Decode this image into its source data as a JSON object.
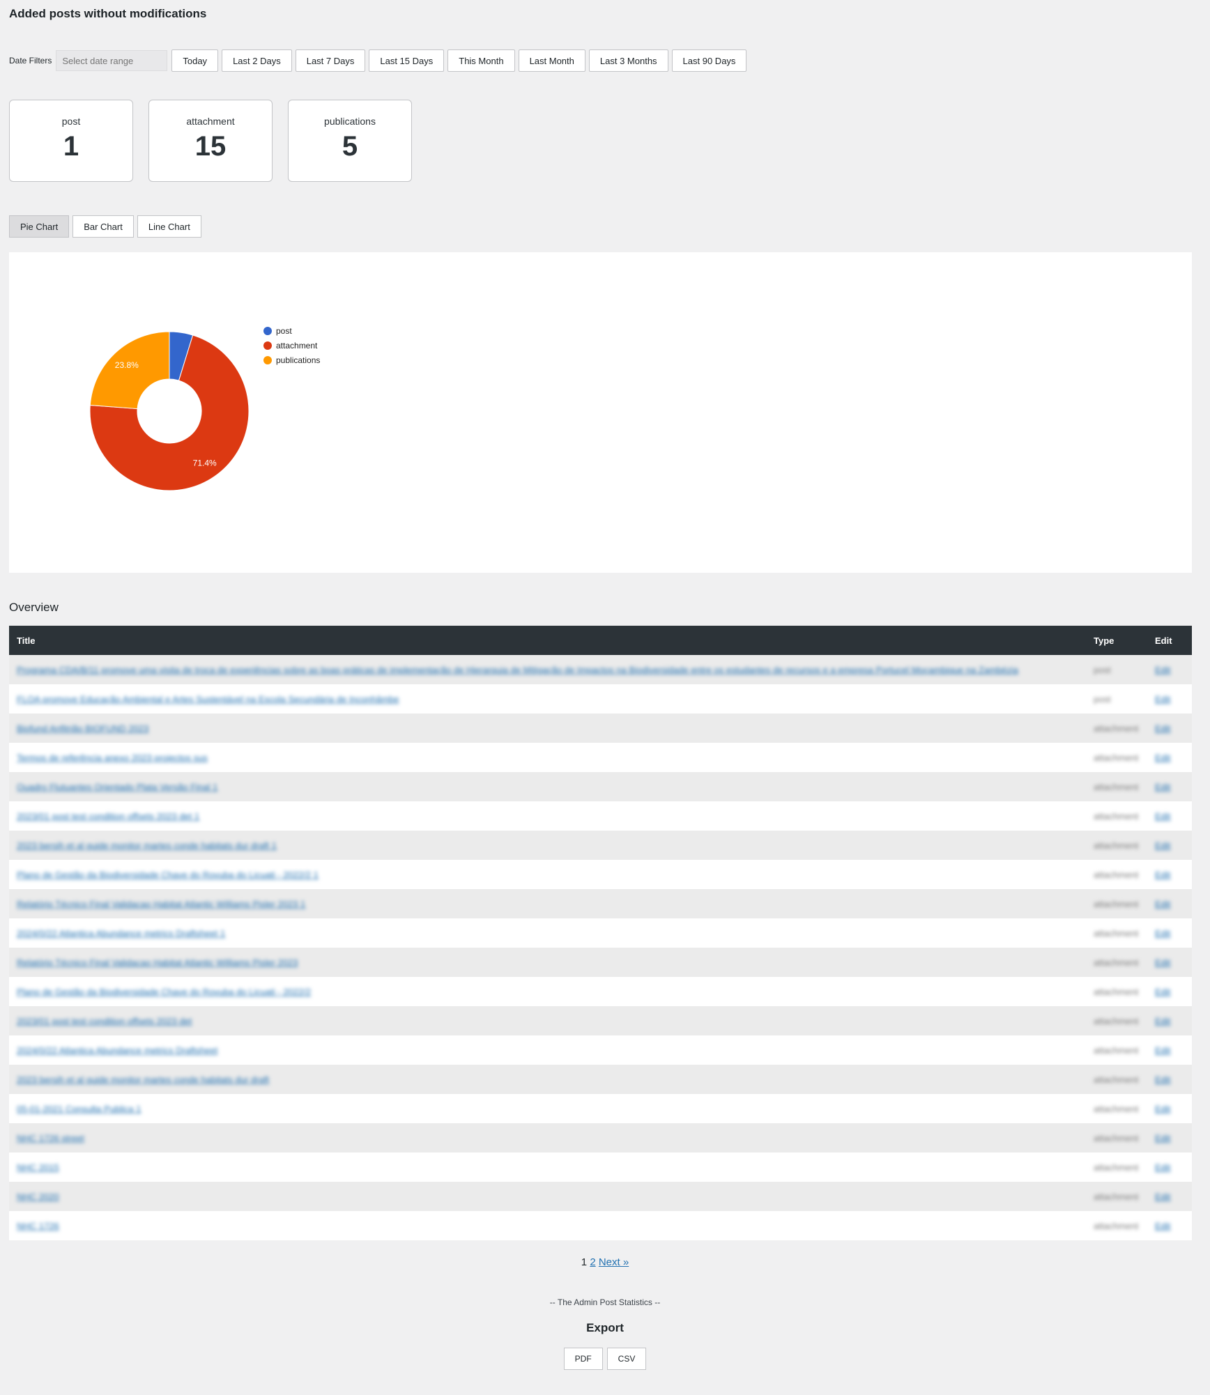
{
  "page": {
    "title": "Added posts without modifications"
  },
  "filters": {
    "label": "Date Filters",
    "date_range_placeholder": "Select date range",
    "buttons": [
      "Today",
      "Last 2 Days",
      "Last 7 Days",
      "Last 15 Days",
      "This Month",
      "Last Month",
      "Last 3 Months",
      "Last 90 Days"
    ]
  },
  "cards": [
    {
      "name": "post",
      "count": "1"
    },
    {
      "name": "attachment",
      "count": "15"
    },
    {
      "name": "publications",
      "count": "5"
    }
  ],
  "chart_tabs": [
    {
      "label": "Pie Chart",
      "active": true
    },
    {
      "label": "Bar Chart",
      "active": false
    },
    {
      "label": "Line Chart",
      "active": false
    }
  ],
  "chart_data": {
    "type": "pie",
    "donut": true,
    "categories": [
      "post",
      "attachment",
      "publications"
    ],
    "values": [
      1,
      15,
      5
    ],
    "slice_labels": [
      "",
      "71.4%",
      "23.8%"
    ],
    "colors": [
      "#3366cc",
      "#dc3912",
      "#ff9900"
    ],
    "legend_position": "right"
  },
  "overview": {
    "title": "Overview",
    "columns": [
      "Title",
      "Type",
      "Edit"
    ],
    "rows": [
      {
        "title": "Programa CDA/B/11 promove uma visita de troca de experiências sobre as boas práticas de implementação de Hierarquia de Mitigação de Impactos na Biodiversidade entre os estudantes de recursos e a empresa Portucel Moçambique na Zambézia",
        "type": "post",
        "edit": "Edit"
      },
      {
        "title": "FLOA promove Educação Ambiental e Artes Sustentável na Escola Secundária de Inconhâmbe",
        "type": "post",
        "edit": "Edit"
      },
      {
        "title": "Biofund Anfitrião BIOFUND 2023",
        "type": "attachment",
        "edit": "Edit"
      },
      {
        "title": "Termos de referência anexo 2023 projectos sus",
        "type": "attachment",
        "edit": "Edit"
      },
      {
        "title": "Quadro Flutuantes Orientado Plata Versão Final 1",
        "type": "attachment",
        "edit": "Edit"
      },
      {
        "title": "2023/01 post test condition offsets 2023 det 1",
        "type": "attachment",
        "edit": "Edit"
      },
      {
        "title": "2023 bersih et al guide monitor martes conde habitats dur draft 1",
        "type": "attachment",
        "edit": "Edit"
      },
      {
        "title": "Plano de Gestão da Biodiversidade Chave do Rovuba do Licuati - 2022/2 1",
        "type": "attachment",
        "edit": "Edit"
      },
      {
        "title": "Relatório Técnico Final Validacao Habitat Atlantic Williams Pisler 2023 1",
        "type": "attachment",
        "edit": "Edit"
      },
      {
        "title": "2024/0/22 Atlantica Abundance metrics Draftsheet 1",
        "type": "attachment",
        "edit": "Edit"
      },
      {
        "title": "Relatório Técnico Final Validacao Habitat Atlantic Williams Pisler 2023",
        "type": "attachment",
        "edit": "Edit"
      },
      {
        "title": "Plano de Gestão da Biodiversidade Chave do Rovuba do Licuati - 2022/2",
        "type": "attachment",
        "edit": "Edit"
      },
      {
        "title": "2023/01 post test condition offsets 2023 det",
        "type": "attachment",
        "edit": "Edit"
      },
      {
        "title": "2024/0/22 Atlantica Abundance metrics Draftsheet",
        "type": "attachment",
        "edit": "Edit"
      },
      {
        "title": "2023 bersih et al guide monitor martes conde habitats dur draft",
        "type": "attachment",
        "edit": "Edit"
      },
      {
        "title": "05-01-2021 Consulta Publica 1",
        "type": "attachment",
        "edit": "Edit"
      },
      {
        "title": "NHC 1726 street",
        "type": "attachment",
        "edit": "Edit"
      },
      {
        "title": "NHC 2015",
        "type": "attachment",
        "edit": "Edit"
      },
      {
        "title": "NHC 2020",
        "type": "attachment",
        "edit": "Edit"
      },
      {
        "title": "NHC 1726",
        "type": "attachment",
        "edit": "Edit"
      }
    ]
  },
  "pagination": {
    "current": "1",
    "page2": "2",
    "next": "Next »"
  },
  "footer": {
    "note": "-- The Admin Post Statistics --"
  },
  "export": {
    "title": "Export",
    "pdf": "PDF",
    "csv": "CSV"
  }
}
